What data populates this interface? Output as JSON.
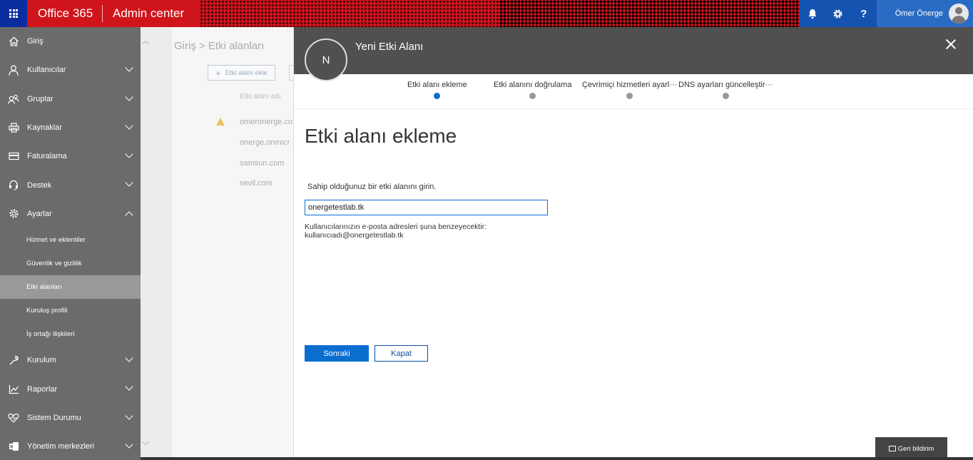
{
  "topbar": {
    "brand": "Office 365",
    "app_title": "Admin center",
    "user_name": "Ömer Önerge",
    "icons": [
      "bell-icon",
      "gear-icon",
      "help-icon"
    ]
  },
  "sidebar": {
    "items": [
      {
        "label": "Giriş",
        "icon": "home-icon"
      },
      {
        "label": "Kullanıcılar",
        "icon": "user-icon"
      },
      {
        "label": "Gruplar",
        "icon": "group-icon"
      },
      {
        "label": "Kaynaklar",
        "icon": "printer-icon"
      },
      {
        "label": "Faturalama",
        "icon": "credit-card-icon"
      },
      {
        "label": "Destek",
        "icon": "headset-icon"
      },
      {
        "label": "Ayarlar",
        "icon": "gear-icon"
      }
    ],
    "settings_sub": [
      {
        "label": "Hizmet ve eklentiler"
      },
      {
        "label": "Güvenlik ve gizlilik"
      },
      {
        "label": "Etki alanları"
      },
      {
        "label": "Kuruluş profili"
      },
      {
        "label": "İş ortağı ilişkileri"
      }
    ],
    "bottom_items": [
      {
        "label": "Kurulum",
        "icon": "wrench-icon"
      },
      {
        "label": "Raporlar",
        "icon": "chart-icon"
      },
      {
        "label": "Sistem Durumu",
        "icon": "heart-icon"
      },
      {
        "label": "Yönetim merkezleri",
        "icon": "exchange-icon"
      }
    ]
  },
  "background": {
    "breadcrumb": "Giriş > Etki alanları",
    "add_button": "Etki alanı ekle",
    "column_header": "Etki alanı adı",
    "rows": [
      "omeronerge.co",
      "onerge.onmicr",
      "samsun.com",
      "sevil.com"
    ]
  },
  "panel": {
    "avatar_letter": "N",
    "title": "Yeni Etki Alanı",
    "steps": [
      {
        "label": "Etki alanı ekleme",
        "active": true
      },
      {
        "label": "Etki alanını doğrulama",
        "active": false
      },
      {
        "label": "Çevrimiçi hizmetleri ayarl···",
        "active": false
      },
      {
        "label": "DNS ayarları güncelleştir···",
        "active": false
      }
    ],
    "section_title": "Etki alanı ekleme",
    "prompt": "Sahip olduğunuz bir etki alanını girin.",
    "domain_value": "onergetestlab.tk",
    "hint_line1": "Kullanıcılarınızın e-posta adresleri şuna benzeyecektir:",
    "hint_line2": "kullanıcıadı@onergetestlab.tk",
    "next_button": "Sonraki",
    "close_button": "Kapat"
  },
  "feedback": {
    "label": "Geri bildirim"
  },
  "colors": {
    "accent": "#0a6ed1",
    "topbar": "#d0141c",
    "sidebar": "#6b6b6b",
    "panel_header": "#505050"
  }
}
